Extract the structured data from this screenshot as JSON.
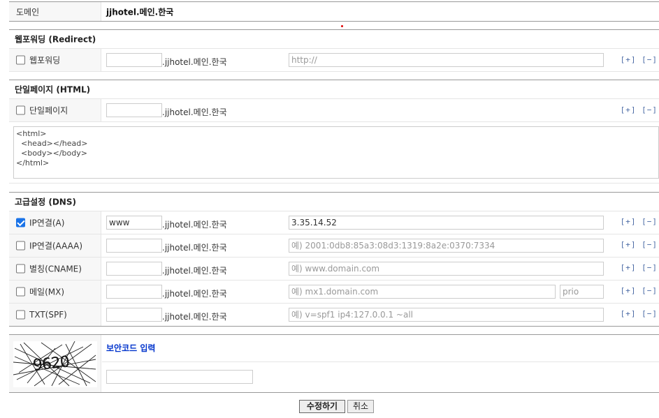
{
  "domain_row": {
    "label": "도메인",
    "value": "jjhotel.메인.한국"
  },
  "suffix": ".jjhotel.메인.한국",
  "add_remove": "[+] [−]",
  "redirect": {
    "section_title": "웹포워딩 (Redirect)",
    "row_label": "웹포워딩",
    "url_placeholder": "http://"
  },
  "html_page": {
    "section_title": "단일페이지 (HTML)",
    "row_label": "단일페이지",
    "code": "<html>\n  <head></head>\n  <body></body>\n</html>"
  },
  "dns": {
    "section_title": "고급설정 (DNS)",
    "records": [
      {
        "label": "IP연결(A)",
        "checked": true,
        "host": "www",
        "value": "3.35.14.52",
        "placeholder": ""
      },
      {
        "label": "IP연결(AAAA)",
        "checked": false,
        "host": "",
        "value": "",
        "placeholder": "예) 2001:0db8:85a3:08d3:1319:8a2e:0370:7334"
      },
      {
        "label": "별칭(CNAME)",
        "checked": false,
        "host": "",
        "value": "",
        "placeholder": "예) www.domain.com"
      },
      {
        "label": "메일(MX)",
        "checked": false,
        "host": "",
        "value": "",
        "placeholder": "예) mx1.domain.com",
        "prio_placeholder": "prio"
      },
      {
        "label": "TXT(SPF)",
        "checked": false,
        "host": "",
        "value": "",
        "placeholder": "예) v=spf1 ip4:127.0.0.1 ~all"
      }
    ]
  },
  "captcha": {
    "title": "보안코드 입력",
    "code": "9620",
    "input_value": ""
  },
  "buttons": {
    "submit": "수정하기",
    "cancel": "취소"
  },
  "colors": {
    "accent_red": "#e00000",
    "link_blue": "#0033cc",
    "checkbox_blue": "#1a73e8"
  }
}
